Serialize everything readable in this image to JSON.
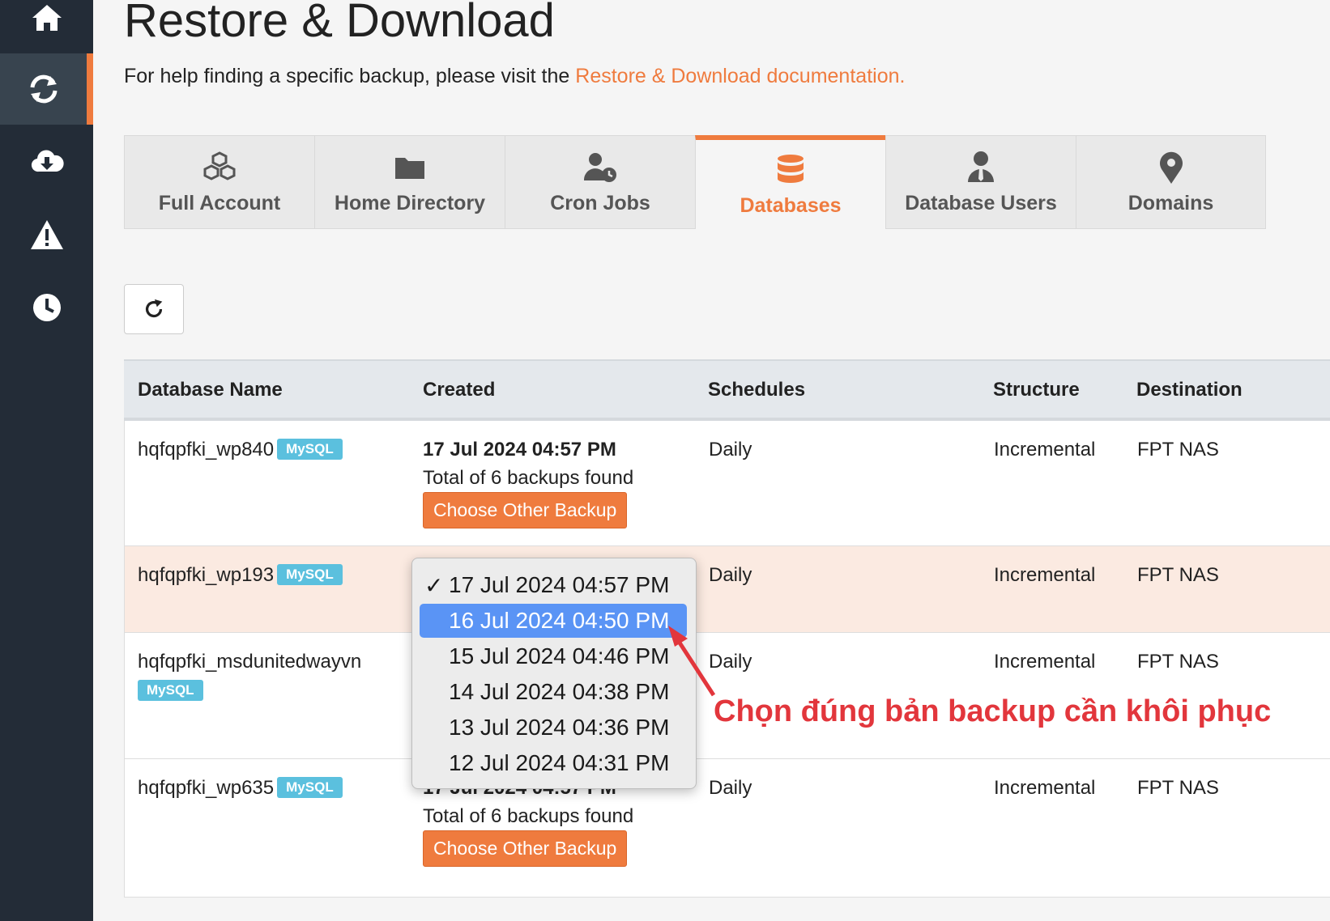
{
  "page": {
    "title": "Restore & Download",
    "help_text": "For help finding a specific backup, please visit the ",
    "help_link": "Restore & Download documentation."
  },
  "sidebar": {
    "items": [
      {
        "icon": "home-icon"
      },
      {
        "icon": "sync-icon",
        "active": true
      },
      {
        "icon": "cloud-download-icon"
      },
      {
        "icon": "warning-icon"
      },
      {
        "icon": "clock-icon"
      }
    ]
  },
  "tabs": [
    {
      "label": "Full Account",
      "icon": "cubes-icon"
    },
    {
      "label": "Home Directory",
      "icon": "folder-icon"
    },
    {
      "label": "Cron Jobs",
      "icon": "user-clock-icon"
    },
    {
      "label": "Databases",
      "icon": "database-icon",
      "active": true
    },
    {
      "label": "Database Users",
      "icon": "user-tie-icon"
    },
    {
      "label": "Domains",
      "icon": "map-marker-icon"
    }
  ],
  "table": {
    "headers": [
      "Database Name",
      "Created",
      "Schedules",
      "Structure",
      "Destination"
    ],
    "rows": [
      {
        "name": "hqfqpfki_wp840",
        "badge": "MySQL",
        "created": "17 Jul 2024 04:57 PM",
        "total": "Total of 6 backups found",
        "button": "Choose Other Backup",
        "schedule": "Daily",
        "structure": "Incremental",
        "destination": "FPT NAS"
      },
      {
        "name": "hqfqpfki_wp193",
        "badge": "MySQL",
        "schedule": "Daily",
        "structure": "Incremental",
        "destination": "FPT NAS"
      },
      {
        "name": "hqfqpfki_msdunitedwayvn",
        "badge": "MySQL",
        "schedule": "Daily",
        "structure": "Incremental",
        "destination": "FPT NAS"
      },
      {
        "name": "hqfqpfki_wp635",
        "badge": "MySQL",
        "created": "17 Jul 2024 04:57 PM",
        "total": "Total of 6 backups found",
        "button": "Choose Other Backup",
        "schedule": "Daily",
        "structure": "Incremental",
        "destination": "FPT NAS"
      }
    ]
  },
  "dropdown": {
    "checkmark": "✓",
    "options": [
      "17 Jul 2024 04:57 PM",
      "16 Jul 2024 04:50 PM",
      "15 Jul 2024 04:46 PM",
      "14 Jul 2024 04:38 PM",
      "13 Jul 2024 04:36 PM",
      "12 Jul 2024 04:31 PM"
    ],
    "checked_index": 0,
    "highlighted_index": 1
  },
  "annotation": {
    "text": "Chọn đúng bản backup cần khôi phục",
    "color": "#e2363c"
  },
  "colors": {
    "accent": "#ef7b3e",
    "sidebar": "#232c37",
    "badge": "#5bc0de",
    "selection": "#5a94f5"
  }
}
